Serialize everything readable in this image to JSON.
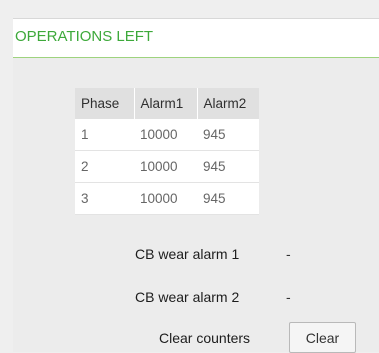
{
  "panel": {
    "title": "OPERATIONS LEFT"
  },
  "table": {
    "headers": [
      "Phase",
      "Alarm1",
      "Alarm2"
    ],
    "rows": [
      [
        "1",
        "10000",
        "945"
      ],
      [
        "2",
        "10000",
        "945"
      ],
      [
        "3",
        "10000",
        "945"
      ]
    ]
  },
  "cb_wear": {
    "alarm1_label": "CB wear alarm 1",
    "alarm1_value": "-",
    "alarm2_label": "CB wear alarm 2",
    "alarm2_value": "-"
  },
  "counters": {
    "label": "Clear counters",
    "button_label": "Clear"
  },
  "colors": {
    "title_green": "#3da93a",
    "header_rule": "#9ed37e",
    "background": "#ececec"
  }
}
